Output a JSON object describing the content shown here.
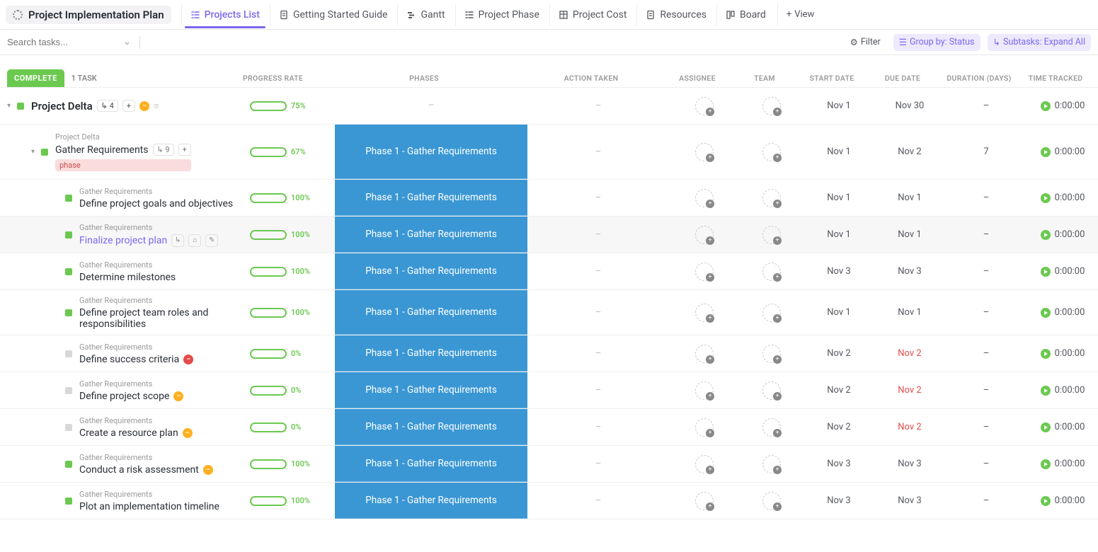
{
  "header": {
    "title": "Project Implementation Plan",
    "tabs": [
      {
        "label": "Projects List",
        "active": true,
        "icon": "list"
      },
      {
        "label": "Getting Started Guide",
        "active": false,
        "icon": "doc"
      },
      {
        "label": "Gantt",
        "active": false,
        "icon": "gantt"
      },
      {
        "label": "Project Phase",
        "active": false,
        "icon": "list"
      },
      {
        "label": "Project Cost",
        "active": false,
        "icon": "table"
      },
      {
        "label": "Resources",
        "active": false,
        "icon": "doc"
      },
      {
        "label": "Board",
        "active": false,
        "icon": "board"
      }
    ],
    "add_view": "View"
  },
  "filters": {
    "search_placeholder": "Search tasks...",
    "filter_label": "Filter",
    "group_label": "Group by: Status",
    "subtasks_label": "Subtasks: Expand All"
  },
  "group": {
    "status": "COMPLETE",
    "count": "1 TASK"
  },
  "columns": {
    "progress": "PROGRESS RATE",
    "phases": "PHASES",
    "action": "ACTION TAKEN",
    "assignee": "ASSIGNEE",
    "team": "TEAM",
    "start": "START DATE",
    "due": "DUE DATE",
    "duration": "DURATION (DAYS)",
    "time": "TIME TRACKED"
  },
  "tasks": [
    {
      "level": 0,
      "caret": true,
      "sq": "green",
      "name": "Project Delta",
      "bold": true,
      "sub_count": "4",
      "plus": true,
      "priority": "orange",
      "desc": true,
      "progress": 75,
      "phase": "",
      "action": "–",
      "start": "Nov 1",
      "due": "Nov 30",
      "due_red": false,
      "dur": "–",
      "time": "0:00:00"
    },
    {
      "level": 1,
      "caret": true,
      "sq": "green",
      "parent": "Project Delta",
      "name": "Gather Requirements",
      "sub_count": "9",
      "plus": true,
      "tag": "phase",
      "progress": 67,
      "phase": "Phase 1 - Gather Requirements",
      "action": "–",
      "start": "Nov 1",
      "due": "Nov 2",
      "due_red": false,
      "dur": "7",
      "time": "0:00:00"
    },
    {
      "level": 2,
      "sq": "green",
      "parent": "Gather Requirements",
      "name": "Define project goals and objectives",
      "progress": 100,
      "phase": "Phase 1 - Gather Requirements",
      "action": "–",
      "start": "Nov 1",
      "due": "Nov 1",
      "due_red": false,
      "dur": "–",
      "time": "0:00:00"
    },
    {
      "level": 2,
      "sq": "green",
      "parent": "Gather Requirements",
      "name": "Finalize project plan",
      "purple": true,
      "hover": true,
      "icons": true,
      "progress": 100,
      "phase": "Phase 1 - Gather Requirements",
      "action": "–",
      "start": "Nov 1",
      "due": "Nov 1",
      "due_red": false,
      "dur": "–",
      "time": "0:00:00"
    },
    {
      "level": 2,
      "sq": "green",
      "parent": "Gather Requirements",
      "name": "Determine milestones",
      "progress": 100,
      "phase": "Phase 1 - Gather Requirements",
      "action": "–",
      "start": "Nov 3",
      "due": "Nov 3",
      "due_red": false,
      "dur": "–",
      "time": "0:00:00"
    },
    {
      "level": 2,
      "sq": "green",
      "parent": "Gather Requirements",
      "name": "Define project team roles and responsibilities",
      "progress": 100,
      "phase": "Phase 1 - Gather Requirements",
      "action": "–",
      "start": "Nov 1",
      "due": "Nov 1",
      "due_red": false,
      "dur": "–",
      "time": "0:00:00",
      "tall": true
    },
    {
      "level": 2,
      "sq": "grey",
      "parent": "Gather Requirements",
      "name": "Define success criteria",
      "priority": "red",
      "progress": 0,
      "phase": "Phase 1 - Gather Requirements",
      "action": "–",
      "start": "Nov 2",
      "due": "Nov 2",
      "due_red": true,
      "dur": "–",
      "time": "0:00:00"
    },
    {
      "level": 2,
      "sq": "grey",
      "parent": "Gather Requirements",
      "name": "Define project scope",
      "priority": "orange",
      "progress": 0,
      "phase": "Phase 1 - Gather Requirements",
      "action": "–",
      "start": "Nov 2",
      "due": "Nov 2",
      "due_red": true,
      "dur": "–",
      "time": "0:00:00"
    },
    {
      "level": 2,
      "sq": "grey",
      "parent": "Gather Requirements",
      "name": "Create a resource plan",
      "priority": "orange",
      "progress": 0,
      "phase": "Phase 1 - Gather Requirements",
      "action": "–",
      "start": "Nov 2",
      "due": "Nov 2",
      "due_red": true,
      "dur": "–",
      "time": "0:00:00"
    },
    {
      "level": 2,
      "sq": "green",
      "parent": "Gather Requirements",
      "name": "Conduct a risk assessment",
      "priority": "orange",
      "progress": 100,
      "phase": "Phase 1 - Gather Requirements",
      "action": "–",
      "start": "Nov 3",
      "due": "Nov 3",
      "due_red": false,
      "dur": "–",
      "time": "0:00:00"
    },
    {
      "level": 2,
      "sq": "green",
      "parent": "Gather Requirements",
      "name": "Plot an implementation timeline",
      "progress": 100,
      "phase": "Phase 1 - Gather Requirements",
      "action": "–",
      "start": "Nov 3",
      "due": "Nov 3",
      "due_red": false,
      "dur": "–",
      "time": "0:00:00"
    }
  ]
}
